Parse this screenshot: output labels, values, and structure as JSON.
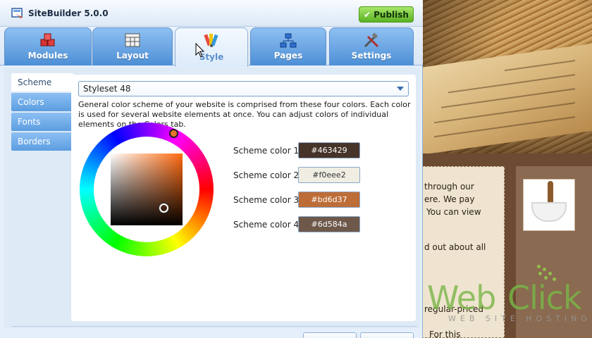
{
  "app": {
    "title": "SiteBuilder 5.0.0",
    "publish_label": "Publish"
  },
  "tabs": [
    {
      "label": "Modules",
      "icon": "modules-icon",
      "active": false
    },
    {
      "label": "Layout",
      "icon": "layout-icon",
      "active": false
    },
    {
      "label": "Style",
      "icon": "palette-icon",
      "active": true
    },
    {
      "label": "Pages",
      "icon": "sitemap-icon",
      "active": false
    },
    {
      "label": "Settings",
      "icon": "tools-icon",
      "active": false
    }
  ],
  "sidebar": {
    "items": [
      {
        "label": "Scheme",
        "active": true
      },
      {
        "label": "Colors",
        "active": false
      },
      {
        "label": "Fonts",
        "active": false
      },
      {
        "label": "Borders",
        "active": false
      }
    ]
  },
  "scheme": {
    "selected": "Styleset 48",
    "description": "General color scheme of your website is comprised from these four colors. Each color is used for several website elements at once. You can adjust colors of individual elements on the Colors tab.",
    "colors": [
      {
        "label": "Scheme color 1",
        "value": "#463429",
        "hex": "#463429",
        "text_color": "#ffffff"
      },
      {
        "label": "Scheme color 2",
        "value": "#f0eee2",
        "hex": "#f0eee2",
        "text_color": "#333333"
      },
      {
        "label": "Scheme color 3",
        "value": "#bd6d37",
        "hex": "#bd6d37",
        "text_color": "#ffffff"
      },
      {
        "label": "Scheme color 4",
        "value": "#6d584a",
        "hex": "#6d584a",
        "text_color": "#ffffff"
      }
    ]
  },
  "background_site": {
    "text_lines": [
      "through our",
      "ere. We pay",
      "You can view",
      "d out about all",
      "regular-priced",
      "For this"
    ],
    "watermark": {
      "part1": "Web",
      "part2": "Click",
      "tagline": "WEB SITE HOSTING"
    }
  }
}
